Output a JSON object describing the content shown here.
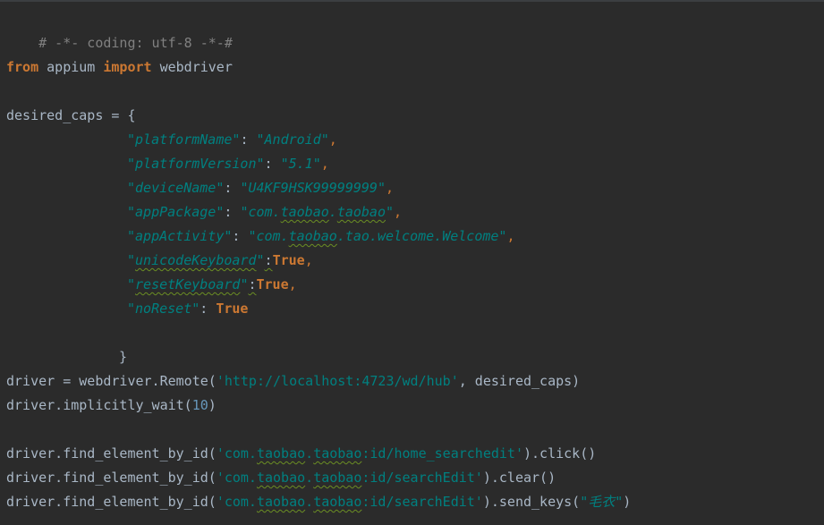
{
  "editor": {
    "lines": {
      "l1": "# -*- coding: utf-8 -*-#",
      "l2_from": "from",
      "l2_mod": " appium ",
      "l2_import": "import",
      "l2_name": " webdriver",
      "l3_var": "desired_caps = {",
      "caps": [
        {
          "key": "\"platformName\"",
          "sep": ": ",
          "val": "\"Android\"",
          "end": ","
        },
        {
          "key": "\"platformVersion\"",
          "sep": ": ",
          "val": "\"5.1\"",
          "end": ","
        },
        {
          "key": "\"deviceName\"",
          "sep": ": ",
          "val": "\"U4KF9HSK99999999\"",
          "end": ","
        },
        {
          "key": "\"appPackage\"",
          "sep": ": ",
          "val_pre": "\"com.",
          "val_sq1": "taobao",
          "val_mid": ".",
          "val_sq2": "taobao",
          "val_post": "\"",
          "end": ","
        },
        {
          "key": "\"appActivity\"",
          "sep": ": ",
          "val_pre": "\"com.",
          "val_sq1": "taobao",
          "val_post": ".tao.welcome.Welcome\"",
          "end": ","
        },
        {
          "key_pre": "\"",
          "key_sq": "unicodeKeyboard",
          "key_post": "\"",
          "sep": ":",
          "val": "True",
          "end": ","
        },
        {
          "key_pre": "\"",
          "key_sq": "resetKeyboard",
          "key_post": "\"",
          "sep": ":",
          "val": "True",
          "end": ","
        },
        {
          "key": "\"noReset\"",
          "sep": ": ",
          "val": "True"
        }
      ],
      "close_brace": "}",
      "remote_pre": "driver = webdriver.Remote(",
      "remote_url": "'http://localhost:4723/wd/hub'",
      "remote_post": ", desired_caps)",
      "wait_pre": "driver.implicitly_wait(",
      "wait_num": "10",
      "wait_post": ")",
      "find_pre": "driver.find_element_by_id(",
      "find1_a": "'com.",
      "find1_sq1": "taobao",
      "find1_b": ".",
      "find1_sq2": "taobao",
      "find1_c": ":id/home_searchedit'",
      "find1_post": ").click()",
      "find2_a": "'com.",
      "find2_sq1": "taobao",
      "find2_b": ".",
      "find2_sq2": "taobao",
      "find2_c": ":id/searchEdit'",
      "find2_post": ").clear()",
      "find3_a": "'com.",
      "find3_sq1": "taobao",
      "find3_b": ".",
      "find3_sq2": "taobao",
      "find3_c": ":id/searchEdit'",
      "find3_mid": ").send_keys(",
      "find3_str": "\"毛衣\"",
      "find3_post": ")"
    }
  }
}
